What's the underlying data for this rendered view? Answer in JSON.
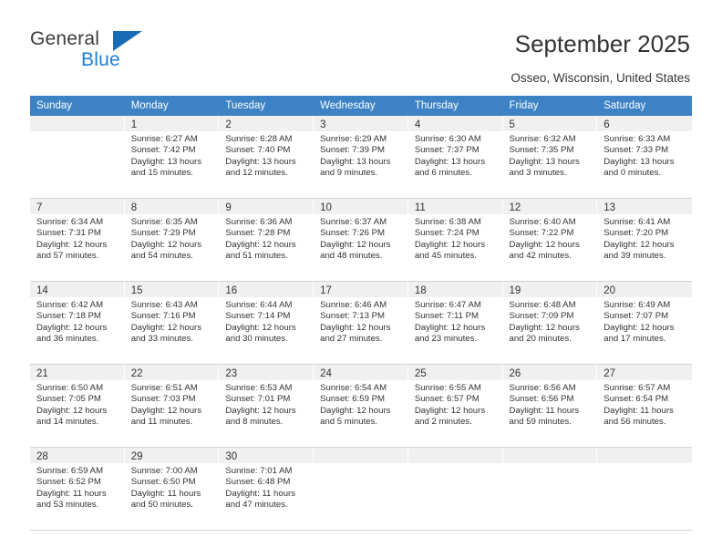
{
  "brand": {
    "name_part1": "General",
    "name_part2": "Blue",
    "accent_color": "#1a7fd4",
    "triangle_color": "#1a6cb5"
  },
  "header": {
    "title": "September 2025",
    "subtitle": "Osseo, Wisconsin, United States"
  },
  "calendar": {
    "header_bg": "#3c82c4",
    "daynum_bg": "#f0f0f0",
    "weekday_headers": [
      "Sunday",
      "Monday",
      "Tuesday",
      "Wednesday",
      "Thursday",
      "Friday",
      "Saturday"
    ],
    "weeks": [
      [
        {
          "day": "",
          "sunrise": "",
          "sunset": "",
          "daylight1": "",
          "daylight2": ""
        },
        {
          "day": "1",
          "sunrise": "Sunrise: 6:27 AM",
          "sunset": "Sunset: 7:42 PM",
          "daylight1": "Daylight: 13 hours",
          "daylight2": "and 15 minutes."
        },
        {
          "day": "2",
          "sunrise": "Sunrise: 6:28 AM",
          "sunset": "Sunset: 7:40 PM",
          "daylight1": "Daylight: 13 hours",
          "daylight2": "and 12 minutes."
        },
        {
          "day": "3",
          "sunrise": "Sunrise: 6:29 AM",
          "sunset": "Sunset: 7:39 PM",
          "daylight1": "Daylight: 13 hours",
          "daylight2": "and 9 minutes."
        },
        {
          "day": "4",
          "sunrise": "Sunrise: 6:30 AM",
          "sunset": "Sunset: 7:37 PM",
          "daylight1": "Daylight: 13 hours",
          "daylight2": "and 6 minutes."
        },
        {
          "day": "5",
          "sunrise": "Sunrise: 6:32 AM",
          "sunset": "Sunset: 7:35 PM",
          "daylight1": "Daylight: 13 hours",
          "daylight2": "and 3 minutes."
        },
        {
          "day": "6",
          "sunrise": "Sunrise: 6:33 AM",
          "sunset": "Sunset: 7:33 PM",
          "daylight1": "Daylight: 13 hours",
          "daylight2": "and 0 minutes."
        }
      ],
      [
        {
          "day": "7",
          "sunrise": "Sunrise: 6:34 AM",
          "sunset": "Sunset: 7:31 PM",
          "daylight1": "Daylight: 12 hours",
          "daylight2": "and 57 minutes."
        },
        {
          "day": "8",
          "sunrise": "Sunrise: 6:35 AM",
          "sunset": "Sunset: 7:29 PM",
          "daylight1": "Daylight: 12 hours",
          "daylight2": "and 54 minutes."
        },
        {
          "day": "9",
          "sunrise": "Sunrise: 6:36 AM",
          "sunset": "Sunset: 7:28 PM",
          "daylight1": "Daylight: 12 hours",
          "daylight2": "and 51 minutes."
        },
        {
          "day": "10",
          "sunrise": "Sunrise: 6:37 AM",
          "sunset": "Sunset: 7:26 PM",
          "daylight1": "Daylight: 12 hours",
          "daylight2": "and 48 minutes."
        },
        {
          "day": "11",
          "sunrise": "Sunrise: 6:38 AM",
          "sunset": "Sunset: 7:24 PM",
          "daylight1": "Daylight: 12 hours",
          "daylight2": "and 45 minutes."
        },
        {
          "day": "12",
          "sunrise": "Sunrise: 6:40 AM",
          "sunset": "Sunset: 7:22 PM",
          "daylight1": "Daylight: 12 hours",
          "daylight2": "and 42 minutes."
        },
        {
          "day": "13",
          "sunrise": "Sunrise: 6:41 AM",
          "sunset": "Sunset: 7:20 PM",
          "daylight1": "Daylight: 12 hours",
          "daylight2": "and 39 minutes."
        }
      ],
      [
        {
          "day": "14",
          "sunrise": "Sunrise: 6:42 AM",
          "sunset": "Sunset: 7:18 PM",
          "daylight1": "Daylight: 12 hours",
          "daylight2": "and 36 minutes."
        },
        {
          "day": "15",
          "sunrise": "Sunrise: 6:43 AM",
          "sunset": "Sunset: 7:16 PM",
          "daylight1": "Daylight: 12 hours",
          "daylight2": "and 33 minutes."
        },
        {
          "day": "16",
          "sunrise": "Sunrise: 6:44 AM",
          "sunset": "Sunset: 7:14 PM",
          "daylight1": "Daylight: 12 hours",
          "daylight2": "and 30 minutes."
        },
        {
          "day": "17",
          "sunrise": "Sunrise: 6:46 AM",
          "sunset": "Sunset: 7:13 PM",
          "daylight1": "Daylight: 12 hours",
          "daylight2": "and 27 minutes."
        },
        {
          "day": "18",
          "sunrise": "Sunrise: 6:47 AM",
          "sunset": "Sunset: 7:11 PM",
          "daylight1": "Daylight: 12 hours",
          "daylight2": "and 23 minutes."
        },
        {
          "day": "19",
          "sunrise": "Sunrise: 6:48 AM",
          "sunset": "Sunset: 7:09 PM",
          "daylight1": "Daylight: 12 hours",
          "daylight2": "and 20 minutes."
        },
        {
          "day": "20",
          "sunrise": "Sunrise: 6:49 AM",
          "sunset": "Sunset: 7:07 PM",
          "daylight1": "Daylight: 12 hours",
          "daylight2": "and 17 minutes."
        }
      ],
      [
        {
          "day": "21",
          "sunrise": "Sunrise: 6:50 AM",
          "sunset": "Sunset: 7:05 PM",
          "daylight1": "Daylight: 12 hours",
          "daylight2": "and 14 minutes."
        },
        {
          "day": "22",
          "sunrise": "Sunrise: 6:51 AM",
          "sunset": "Sunset: 7:03 PM",
          "daylight1": "Daylight: 12 hours",
          "daylight2": "and 11 minutes."
        },
        {
          "day": "23",
          "sunrise": "Sunrise: 6:53 AM",
          "sunset": "Sunset: 7:01 PM",
          "daylight1": "Daylight: 12 hours",
          "daylight2": "and 8 minutes."
        },
        {
          "day": "24",
          "sunrise": "Sunrise: 6:54 AM",
          "sunset": "Sunset: 6:59 PM",
          "daylight1": "Daylight: 12 hours",
          "daylight2": "and 5 minutes."
        },
        {
          "day": "25",
          "sunrise": "Sunrise: 6:55 AM",
          "sunset": "Sunset: 6:57 PM",
          "daylight1": "Daylight: 12 hours",
          "daylight2": "and 2 minutes."
        },
        {
          "day": "26",
          "sunrise": "Sunrise: 6:56 AM",
          "sunset": "Sunset: 6:56 PM",
          "daylight1": "Daylight: 11 hours",
          "daylight2": "and 59 minutes."
        },
        {
          "day": "27",
          "sunrise": "Sunrise: 6:57 AM",
          "sunset": "Sunset: 6:54 PM",
          "daylight1": "Daylight: 11 hours",
          "daylight2": "and 56 minutes."
        }
      ],
      [
        {
          "day": "28",
          "sunrise": "Sunrise: 6:59 AM",
          "sunset": "Sunset: 6:52 PM",
          "daylight1": "Daylight: 11 hours",
          "daylight2": "and 53 minutes."
        },
        {
          "day": "29",
          "sunrise": "Sunrise: 7:00 AM",
          "sunset": "Sunset: 6:50 PM",
          "daylight1": "Daylight: 11 hours",
          "daylight2": "and 50 minutes."
        },
        {
          "day": "30",
          "sunrise": "Sunrise: 7:01 AM",
          "sunset": "Sunset: 6:48 PM",
          "daylight1": "Daylight: 11 hours",
          "daylight2": "and 47 minutes."
        },
        {
          "day": "",
          "sunrise": "",
          "sunset": "",
          "daylight1": "",
          "daylight2": ""
        },
        {
          "day": "",
          "sunrise": "",
          "sunset": "",
          "daylight1": "",
          "daylight2": ""
        },
        {
          "day": "",
          "sunrise": "",
          "sunset": "",
          "daylight1": "",
          "daylight2": ""
        },
        {
          "day": "",
          "sunrise": "",
          "sunset": "",
          "daylight1": "",
          "daylight2": ""
        }
      ]
    ]
  }
}
